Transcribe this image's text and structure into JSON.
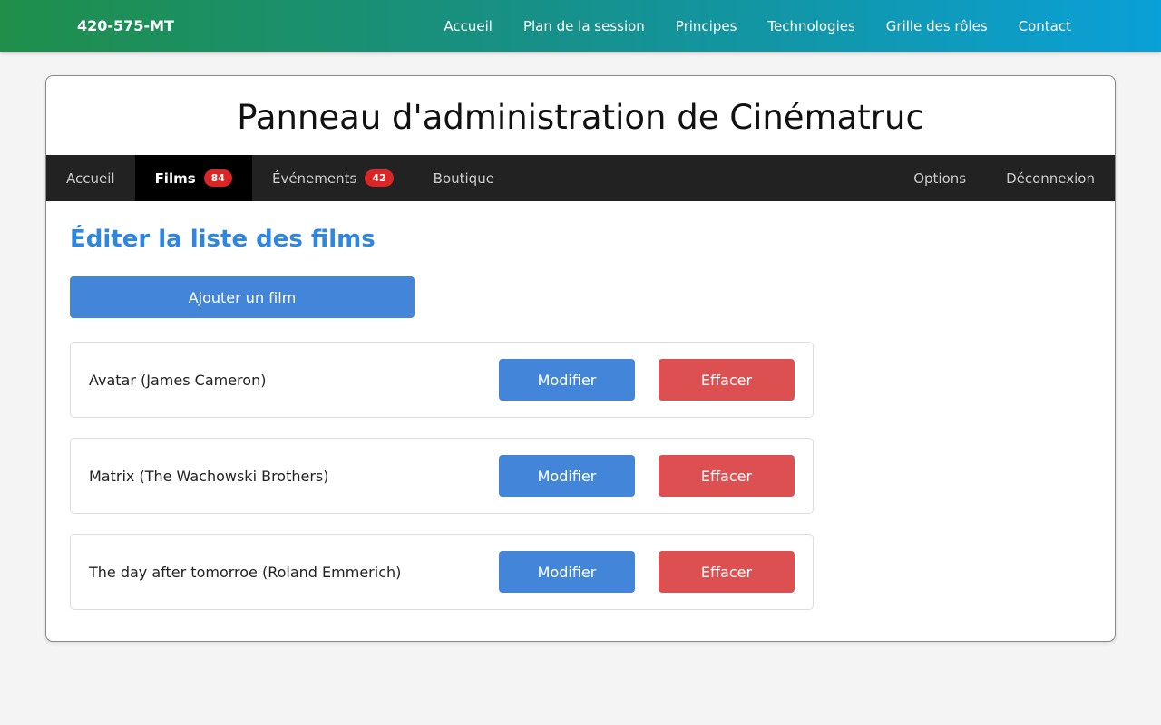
{
  "topbar": {
    "brand": "420-575-MT",
    "links": [
      "Accueil",
      "Plan de la session",
      "Principes",
      "Technologies",
      "Grille des rôles",
      "Contact"
    ]
  },
  "card": {
    "title": "Panneau d'administration de Cinématruc"
  },
  "adminnav": {
    "home": "Accueil",
    "films": {
      "label": "Films",
      "count": "84"
    },
    "events": {
      "label": "Événements",
      "count": "42"
    },
    "shop": "Boutique",
    "options": "Options",
    "logout": "Déconnexion",
    "active": "Films"
  },
  "main": {
    "heading": "Éditer la liste des films",
    "add_button": "Ajouter un film",
    "films": [
      {
        "name": "Avatar (James Cameron)",
        "edit": "Modifier",
        "delete": "Effacer"
      },
      {
        "name": "Matrix (The Wachowski Brothers)",
        "edit": "Modifier",
        "delete": "Effacer"
      },
      {
        "name": "The day after tomorroe (Roland Emmerich)",
        "edit": "Modifier",
        "delete": "Effacer"
      }
    ]
  },
  "colors": {
    "primary": "#4385d8",
    "danger": "#dc5052",
    "badge": "#dc2626",
    "heading": "#2f86e0",
    "adminnav": "#222222"
  }
}
